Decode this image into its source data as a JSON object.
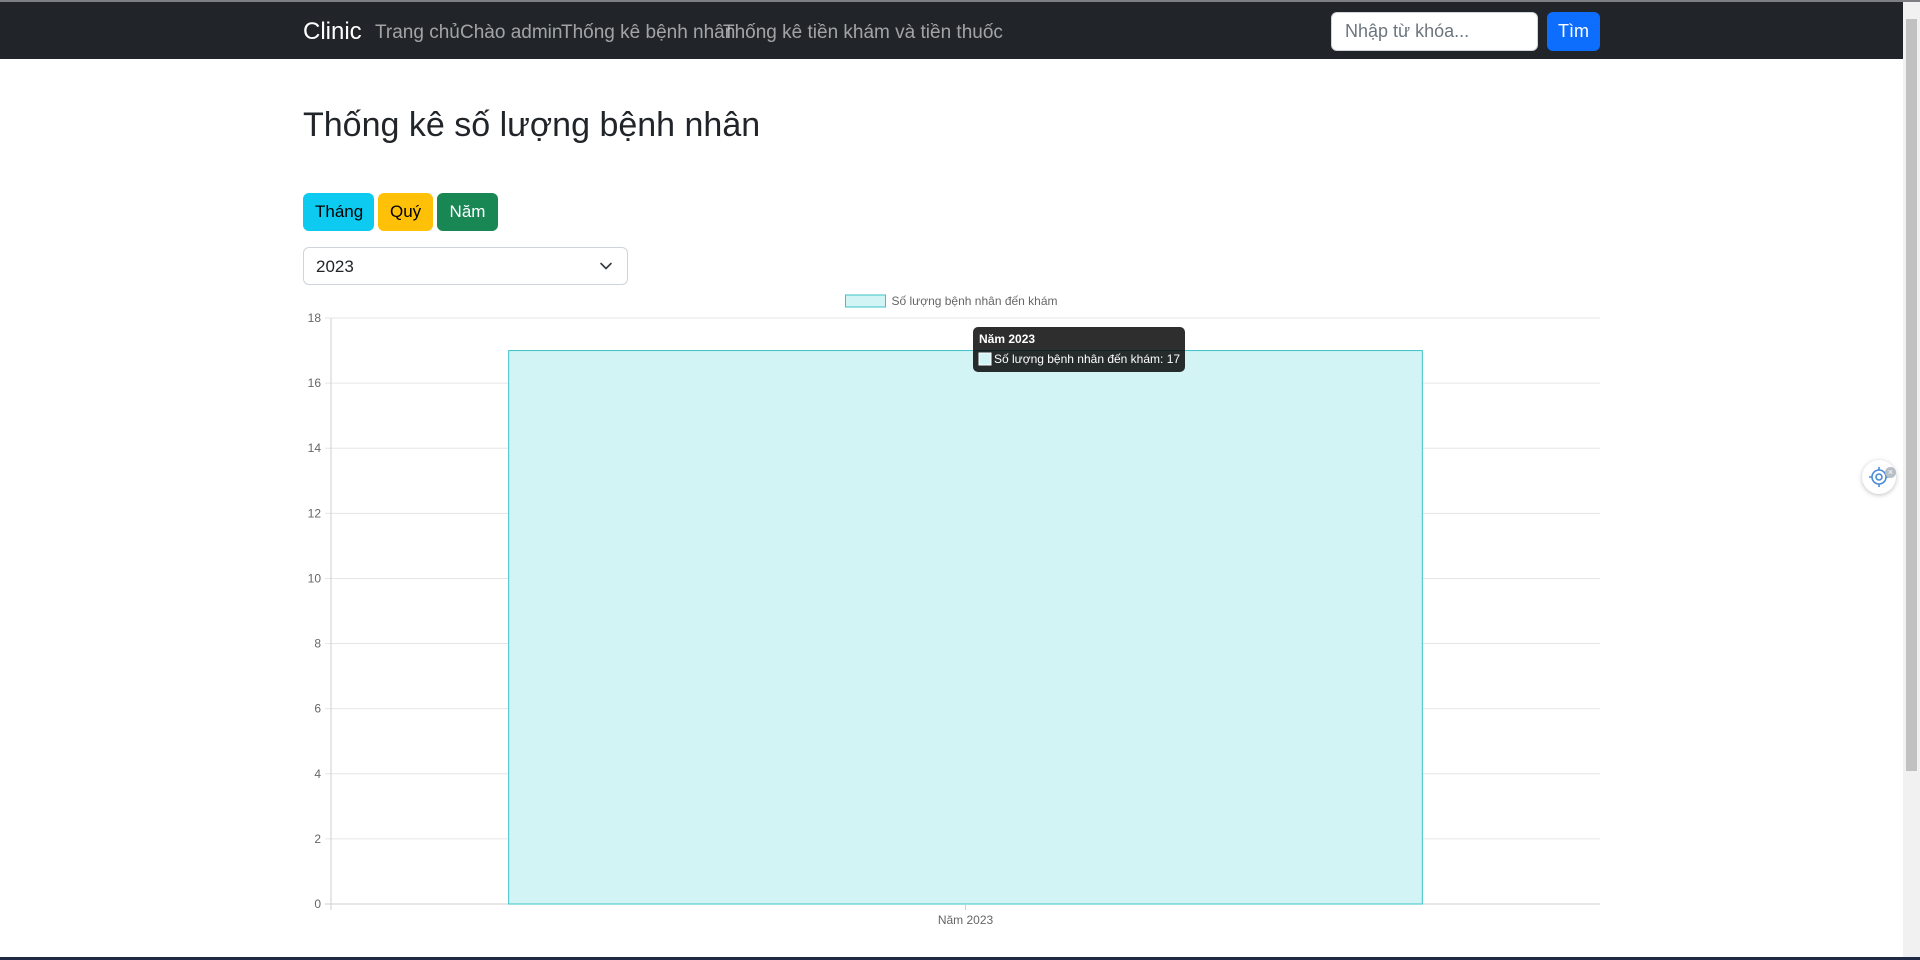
{
  "navbar": {
    "brand": "Clinic",
    "links": [
      "Trang chủ",
      "Chào admin",
      "Thống kê bệnh nhân",
      "Thống kê tiền khám và tiền thuốc"
    ],
    "search_placeholder": "Nhập từ khóa...",
    "search_button": "Tìm"
  },
  "page": {
    "title": "Thống kê số lượng bệnh nhân",
    "period_buttons": {
      "month": "Tháng",
      "quarter": "Quý",
      "year": "Năm"
    },
    "year_select": {
      "selected": "2023"
    }
  },
  "tooltip": {
    "title": "Năm 2023",
    "label": "Số lượng bệnh nhân đến khám: 17"
  },
  "colors": {
    "bar_fill": "#d2f4f4",
    "bar_border": "#3cc3c8",
    "navbar": "#212529",
    "primary": "#0d6efd",
    "info": "#0dcaf0",
    "warning": "#ffc107",
    "success": "#198754"
  },
  "chart_data": {
    "type": "bar",
    "categories": [
      "Năm 2023"
    ],
    "series": [
      {
        "name": "Số lượng bệnh nhân đến khám",
        "values": [
          17
        ]
      }
    ],
    "ylim": [
      0,
      18
    ],
    "yticks": [
      0,
      2,
      4,
      6,
      8,
      10,
      12,
      14,
      16,
      18
    ],
    "grid": true,
    "legend": "top-center"
  }
}
